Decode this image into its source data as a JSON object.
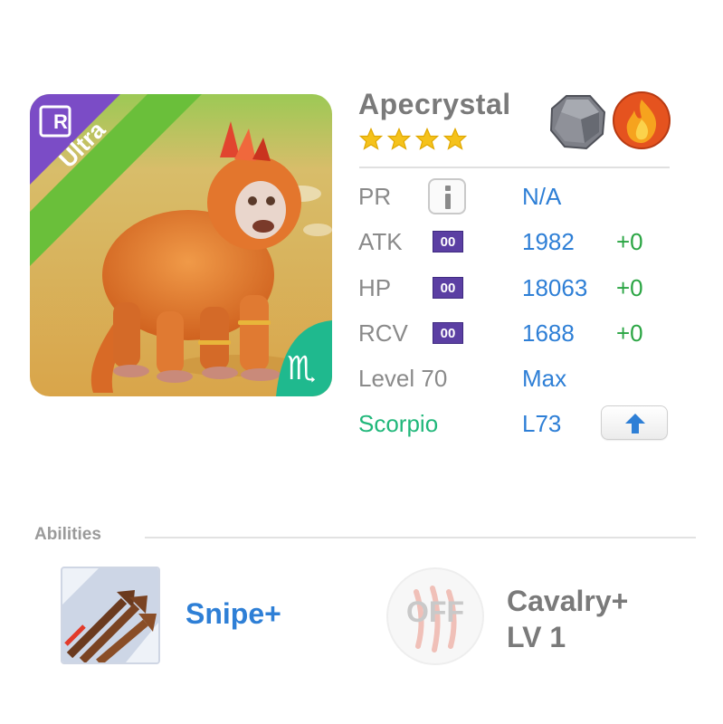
{
  "monster": {
    "name": "Apecrystal",
    "rarity_label": "Ultra",
    "rarity_badge": "R",
    "stars": 4,
    "zodiac_symbol": "♏",
    "portrait_icon": "apecrystal-portrait",
    "elements": [
      "earth-element-icon",
      "fire-element-icon"
    ]
  },
  "stats": {
    "pr": {
      "label": "PR",
      "value": "N/A"
    },
    "atk": {
      "label": "ATK",
      "badge": "00",
      "value": "1982",
      "bonus": "+0"
    },
    "hp": {
      "label": "HP",
      "badge": "00",
      "value": "18063",
      "bonus": "+0"
    },
    "rcv": {
      "label": "RCV",
      "badge": "00",
      "value": "1688",
      "bonus": "+0"
    },
    "level": {
      "label": "Level 70",
      "value": "Max"
    },
    "zodiac": {
      "label": "Scorpio",
      "value": "L73"
    }
  },
  "abilities": {
    "title": "Abilities",
    "items": [
      {
        "name": "Snipe+",
        "icon": "snipe-arrows-icon"
      },
      {
        "name": "Cavalry+",
        "level": "LV 1",
        "status": "OFF",
        "icon": "claw-scratch-icon"
      }
    ]
  },
  "colors": {
    "stat_value": "#2e7fd6",
    "bonus": "#2aa543",
    "zodiac": "#20b77a",
    "badge": "#5b3fa3",
    "ultra_ribbon": "#6abf3a",
    "rarity_corner": "#7b4cc6"
  }
}
